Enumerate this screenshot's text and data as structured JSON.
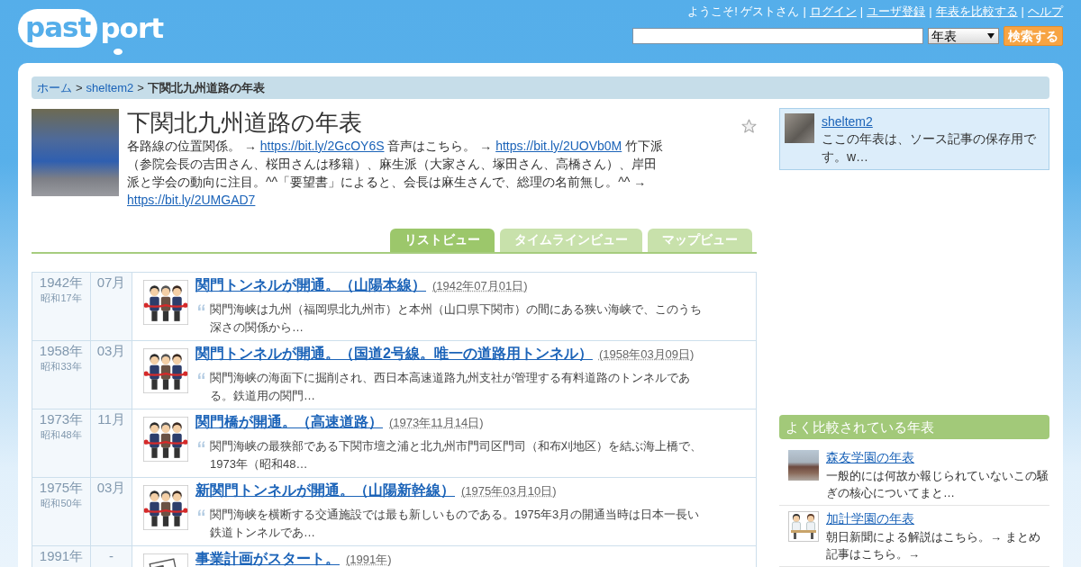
{
  "header": {
    "logo": {
      "cloud_text": "past",
      "text": "port"
    },
    "nav": [
      {
        "kind": "text",
        "text": "ようこそ! ゲストさん"
      },
      {
        "kind": "separator",
        "text": "|"
      },
      {
        "kind": "link",
        "text": "ログイン"
      },
      {
        "kind": "separator",
        "text": "|"
      },
      {
        "kind": "link",
        "text": "ユーザ登録"
      },
      {
        "kind": "separator",
        "text": "|"
      },
      {
        "kind": "link",
        "text": "年表を比較する"
      },
      {
        "kind": "separator",
        "text": "|"
      },
      {
        "kind": "link",
        "text": "ヘルプ"
      }
    ],
    "search": {
      "scope": "年表",
      "button": "検索する"
    }
  },
  "breadcrumb": [
    {
      "kind": "link",
      "text": "ホーム"
    },
    {
      "kind": "separator",
      "text": ">"
    },
    {
      "kind": "link",
      "text": "sheltem2"
    },
    {
      "kind": "separator",
      "text": ">"
    },
    {
      "kind": "current",
      "text": "下関北九州道路の年表"
    }
  ],
  "timeline": {
    "title": "下関北九州道路の年表",
    "description": [
      {
        "kind": "text",
        "text": "各路線の位置関係。 → "
      },
      {
        "kind": "link",
        "text": "https://bit.ly/2GcOY6S"
      },
      {
        "kind": "text",
        "text": " 音声はこちら。 → "
      },
      {
        "kind": "link",
        "text": "https://bit.ly/2UOVb0M"
      },
      {
        "kind": "text",
        "text": " 竹下派（参院会長の吉田さん、桜田さんは移籍）、麻生派（大家さん、塚田さん、高橋さん）、岸田派と学会の動向に注目。^^「要望書」によると、会長は麻生さんで、総理の名前無し。^^ → "
      },
      {
        "kind": "link",
        "text": "https://bit.ly/2UMGAD7"
      }
    ]
  },
  "tabs": [
    {
      "label": "リストビュー",
      "selected": true
    },
    {
      "label": "タイムラインビュー",
      "selected": false
    },
    {
      "label": "マップビュー",
      "selected": false
    }
  ],
  "events": [
    {
      "year": "1942年",
      "era": "昭和17年",
      "month": "07月",
      "kind": "ceremony",
      "title": "関門トンネルが開通。（山陽本線）",
      "date": "(1942年07月01日)",
      "excerpt": "関門海峡は九州（福岡県北九州市）と本州（山口県下関市）の間にある狭い海峡で、このうち深さの関係から…"
    },
    {
      "year": "1958年",
      "era": "昭和33年",
      "month": "03月",
      "kind": "ceremony",
      "title": "関門トンネルが開通。（国道2号線。唯一の道路用トンネル）",
      "date": "(1958年03月09日)",
      "excerpt": "関門海峡の海面下に掘削され、西日本高速道路九州支社が管理する有料道路のトンネルである。鉄道用の関門…"
    },
    {
      "year": "1973年",
      "era": "昭和48年",
      "month": "11月",
      "kind": "ceremony",
      "title": "関門橋が開通。（高速道路）",
      "date": "(1973年11月14日)",
      "excerpt": "関門海峡の最狭部である下関市壇之浦と北九州市門司区門司（和布刈地区）を結ぶ海上橋で、1973年（昭和48…"
    },
    {
      "year": "1975年",
      "era": "昭和50年",
      "month": "03月",
      "kind": "ceremony",
      "title": "新関門トンネルが開通。（山陽新幹線）",
      "date": "(1975年03月10日)",
      "excerpt": "関門海峡を横断する交通施設では最も新しいものである。1975年3月の開通当時は日本一長い鉄道トンネルであ…"
    },
    {
      "year": "1991年",
      "month": "-",
      "kind": "document",
      "title": "事業計画がスタート。",
      "date": "(1991年)"
    }
  ],
  "sidebar": {
    "author": {
      "name": "sheltem2",
      "bio": "ここの年表は、ソース記事の保存用です。w…"
    },
    "compared": {
      "heading": "よく比較されている年表",
      "items": [
        {
          "kind": "photo",
          "title": "森友学園の年表",
          "summary": "一般的には何故か報じられていないこの騒ぎの核心についてまと…"
        },
        {
          "kind": "illustration",
          "title": "加計学園の年表",
          "summary": "朝日新聞による解説はこちら。→ まとめ記事はこちら。→"
        }
      ]
    }
  }
}
